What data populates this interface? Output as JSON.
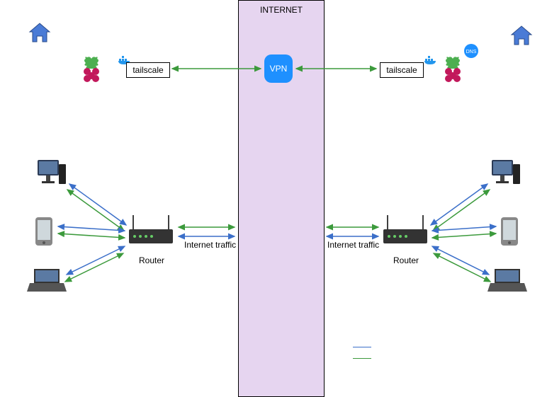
{
  "chart_data": {
    "type": "network-diagram",
    "title": "",
    "central_cloud": {
      "label": "INTERNET",
      "vpn_node": "VPN"
    },
    "sites": [
      {
        "side": "left",
        "home_icon": true,
        "raspberry_pi_node": {
          "docker_badge": true,
          "service_label": "tailscale",
          "dns_badge": false
        },
        "router_label": "Router",
        "internet_traffic_label": "Internet traffic",
        "lan_devices": [
          "desktop",
          "phone",
          "laptop"
        ]
      },
      {
        "side": "right",
        "home_icon": true,
        "raspberry_pi_node": {
          "docker_badge": true,
          "service_label": "tailscale",
          "dns_badge": true
        },
        "router_label": "Router",
        "internet_traffic_label": "Internet traffic",
        "lan_devices": [
          "desktop",
          "phone",
          "laptop"
        ]
      }
    ],
    "links": [
      {
        "from": "left.tailscale",
        "to": "vpn",
        "color": "green",
        "bidir": true
      },
      {
        "from": "right.tailscale",
        "to": "vpn",
        "color": "green",
        "bidir": true
      },
      {
        "from": "left.router",
        "to": "internet",
        "color": "blue",
        "bidir": true,
        "label": "Internet traffic"
      },
      {
        "from": "right.router",
        "to": "internet",
        "color": "blue",
        "bidir": true,
        "label": "Internet traffic"
      },
      {
        "from": "left.router",
        "to": "internet",
        "color": "green",
        "bidir": true
      },
      {
        "from": "right.router",
        "to": "internet",
        "color": "green",
        "bidir": true
      },
      {
        "from": "left.devices",
        "to": "left.router",
        "color": "blue",
        "bidir": true
      },
      {
        "from": "left.devices",
        "to": "left.router",
        "color": "green",
        "bidir": true
      },
      {
        "from": "right.devices",
        "to": "right.router",
        "color": "blue",
        "bidir": true
      },
      {
        "from": "right.devices",
        "to": "right.router",
        "color": "green",
        "bidir": true
      }
    ],
    "legend": {
      "lines": [
        "blue",
        "green"
      ]
    }
  },
  "labels": {
    "internet": "INTERNET",
    "vpn": "VPN",
    "left_tailscale": "tailscale",
    "right_tailscale": "tailscale",
    "left_router": "Router",
    "right_router": "Router",
    "left_traffic": "Internet traffic",
    "right_traffic": "Internet traffic"
  },
  "colors": {
    "green": "#3C9A3C",
    "blue": "#3B6FC9",
    "internet_bg": "#E6D5F0"
  }
}
